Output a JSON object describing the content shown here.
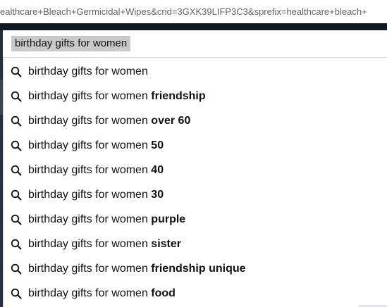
{
  "url": {
    "text": "ealthcare+Bleach+Germicidal+Wipes&crid=3GXK39LIFP3C3&sprefix=healthcare+bleach+"
  },
  "search": {
    "value": "birthday gifts for women"
  },
  "suggestions": [
    {
      "base": "birthday gifts for women",
      "bold": ""
    },
    {
      "base": "birthday gifts for women ",
      "bold": "friendship"
    },
    {
      "base": "birthday gifts for women ",
      "bold": "over 60"
    },
    {
      "base": "birthday gifts for women ",
      "bold": "50"
    },
    {
      "base": "birthday gifts for women ",
      "bold": "40"
    },
    {
      "base": "birthday gifts for women ",
      "bold": "30"
    },
    {
      "base": "birthday gifts for women ",
      "bold": "purple"
    },
    {
      "base": "birthday gifts for women ",
      "bold": "sister"
    },
    {
      "base": "birthday gifts for women ",
      "bold": "friendship unique"
    },
    {
      "base": "birthday gifts for women ",
      "bold": "food"
    }
  ],
  "icons": {
    "suggestion": "search-icon"
  },
  "colors": {
    "header": "#131921",
    "selection": "#c9c9c9",
    "text": "#0f1111"
  }
}
